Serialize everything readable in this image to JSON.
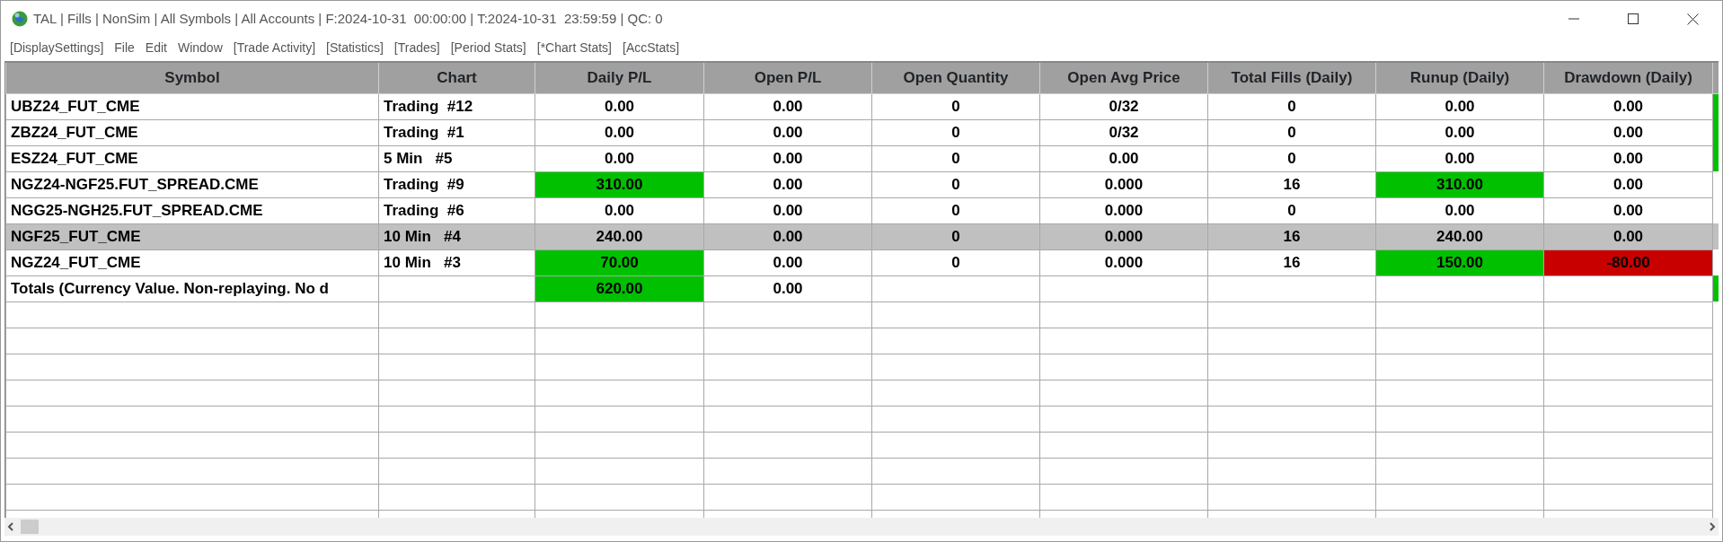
{
  "window": {
    "title": "TAL | Fills | NonSim | All Symbols | All Accounts | F:2024-10-31  00:00:00 | T:2024-10-31  23:59:59 | QC: 0"
  },
  "menu": [
    "[DisplaySettings]",
    "File",
    "Edit",
    "Window",
    "[Trade Activity]",
    "[Statistics]",
    "[Trades]",
    "[Period Stats]",
    "[*Chart Stats]",
    "[AccStats]"
  ],
  "table": {
    "columns": [
      "Symbol",
      "Chart",
      "Daily P/L",
      "Open P/L",
      "Open Quantity",
      "Open Avg Price",
      "Total Fills (Daily)",
      "Runup (Daily)",
      "Drawdown (Daily)"
    ],
    "rows": [
      {
        "selected": false,
        "edge_marker": true,
        "cells": [
          "UBZ24_FUT_CME",
          "Trading  #12",
          "0.00",
          "0.00",
          "0",
          "0/32",
          "0",
          "0.00",
          "0.00"
        ]
      },
      {
        "selected": false,
        "edge_marker": true,
        "cells": [
          "ZBZ24_FUT_CME",
          "Trading  #1",
          "0.00",
          "0.00",
          "0",
          "0/32",
          "0",
          "0.00",
          "0.00"
        ]
      },
      {
        "selected": false,
        "edge_marker": true,
        "cells": [
          "ESZ24_FUT_CME",
          "5 Min   #5",
          "0.00",
          "0.00",
          "0",
          "0.00",
          "0",
          "0.00",
          "0.00"
        ]
      },
      {
        "selected": false,
        "edge_marker": false,
        "cells": [
          "NGZ24-NGF25.FUT_SPREAD.CME",
          "Trading  #9",
          {
            "text": "310.00",
            "color": "#00c000"
          },
          "0.00",
          "0",
          "0.000",
          "16",
          {
            "text": "310.00",
            "color": "#00c000"
          },
          "0.00"
        ]
      },
      {
        "selected": false,
        "edge_marker": false,
        "cells": [
          "NGG25-NGH25.FUT_SPREAD.CME",
          "Trading  #6",
          "0.00",
          "0.00",
          "0",
          "0.000",
          "0",
          "0.00",
          "0.00"
        ]
      },
      {
        "selected": true,
        "edge_marker": false,
        "cells": [
          "NGF25_FUT_CME",
          "10 Min   #4",
          "240.00",
          "0.00",
          "0",
          "0.000",
          "16",
          "240.00",
          "0.00"
        ]
      },
      {
        "selected": false,
        "edge_marker": false,
        "cells": [
          "NGZ24_FUT_CME",
          "10 Min   #3",
          {
            "text": "70.00",
            "color": "#00c000"
          },
          "0.00",
          "0",
          "0.000",
          "16",
          {
            "text": "150.00",
            "color": "#00c000"
          },
          {
            "text": "-80.00",
            "color": "#c80000"
          }
        ]
      }
    ],
    "totals": {
      "label": "Totals (Currency Value. Non-replaying. No d",
      "daily_pl": {
        "text": "620.00",
        "color": "#00c000"
      },
      "open_pl": "0.00",
      "edge_marker": true
    }
  }
}
